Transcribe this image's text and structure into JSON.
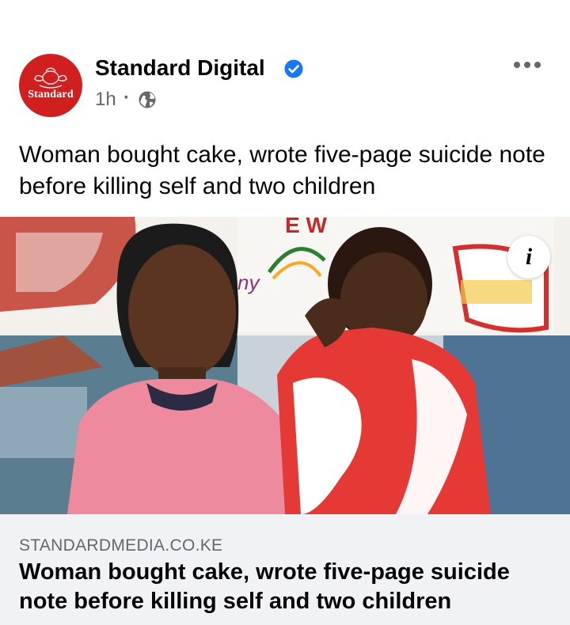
{
  "post": {
    "page_name": "Standard Digital",
    "avatar_text": "Standard",
    "time": "1h",
    "separator": "·",
    "privacy_icon": "globe-icon",
    "verified_icon": "verified-badge-icon",
    "more_icon": "more-options-icon",
    "caption": "Woman bought cake, wrote five-page suicide note before killing self and two children"
  },
  "image": {
    "info_glyph": "i",
    "info_icon": "info-icon"
  },
  "link": {
    "domain": "STANDARDMEDIA.CO.KE",
    "title": "Woman bought cake, wrote five-page suicide note before killing self and two children"
  },
  "colors": {
    "brand_red": "#d01f1f",
    "verified_blue": "#1877f2",
    "secondary_text": "#65676b",
    "link_bg": "#f0f2f5"
  }
}
